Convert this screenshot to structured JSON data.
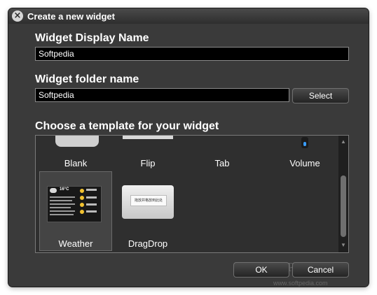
{
  "window": {
    "title": "Create a new widget",
    "close_icon": "close-icon"
  },
  "display_name": {
    "label": "Widget Display Name",
    "value": "Softpedia"
  },
  "folder_name": {
    "label": "Widget folder name",
    "value": "Softpedia",
    "select_label": "Select"
  },
  "templates": {
    "label": "Choose a template for your widget",
    "items": [
      {
        "label": "Blank"
      },
      {
        "label": "Flip"
      },
      {
        "label": "Tab"
      },
      {
        "label": "Volume"
      },
      {
        "label": "Weather",
        "selected": true
      },
      {
        "label": "DragDrop"
      }
    ],
    "weather_thumb_text": "16°C",
    "dragdrop_thumb_text": "拖放并格放到此处"
  },
  "footer": {
    "ok_label": "OK",
    "cancel_label": "Cancel"
  },
  "watermark": {
    "brand": "SOFTPEDIA",
    "url": "www.softpedia.com"
  },
  "colors": {
    "window_bg": "#3a3a3a",
    "field_bg": "#000000",
    "text": "#ffffff",
    "volume_accent": "#3a9dff"
  }
}
